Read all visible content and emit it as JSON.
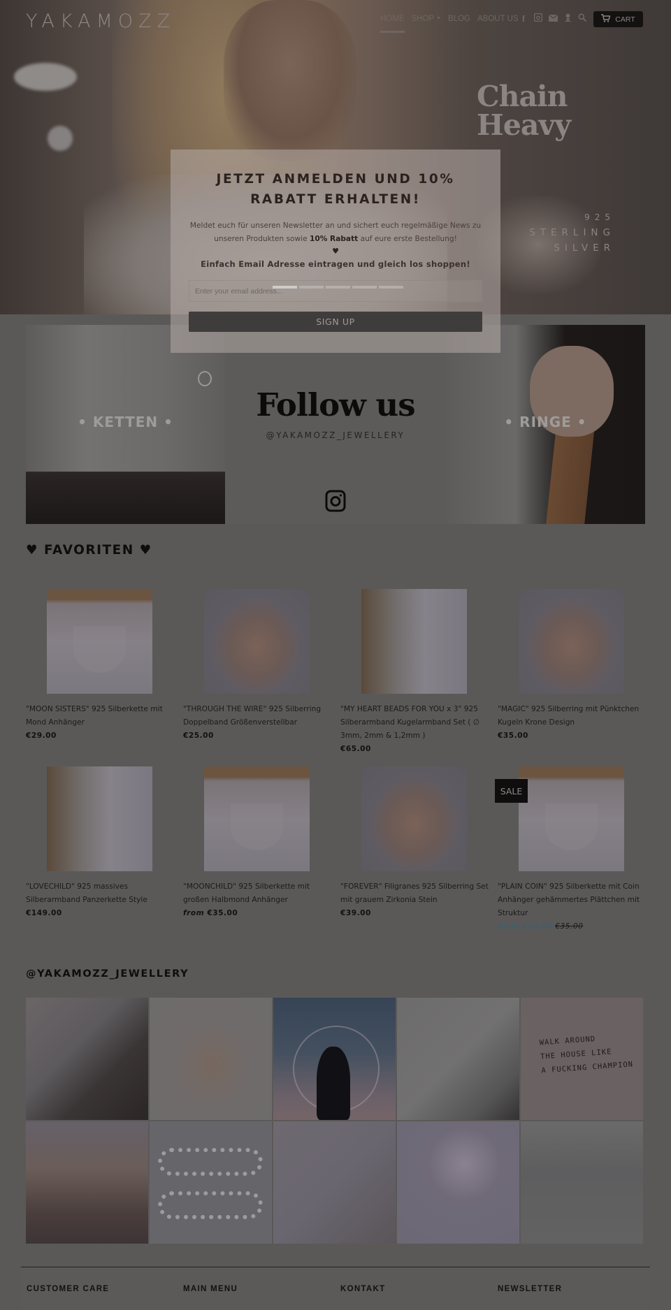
{
  "header": {
    "logo": "YAKAMOZZ",
    "nav": [
      {
        "label": "HOME",
        "active": true
      },
      {
        "label": "SHOP",
        "has_dropdown": true
      },
      {
        "label": "BLOG"
      },
      {
        "label": "ABOUT US"
      }
    ],
    "icons": [
      "facebook-icon",
      "instagram-icon",
      "mail-icon",
      "account-icon",
      "search-icon"
    ],
    "cart_label": "CART"
  },
  "hero": {
    "headline_line1": "Chain",
    "headline_line2": "Heavy",
    "sub_line1": "925",
    "sub_line2": "STERLING",
    "sub_line3": "SILVER"
  },
  "newsletter_popup": {
    "title": "JETZT ANMELDEN UND 10% RABATT ERHALTEN!",
    "desc_before": "Meldet euch für unseren Newsletter an und sichert euch regelmäßige News zu unseren Produkten sowie ",
    "desc_bold": "10% Rabatt",
    "desc_after": " auf eure erste Bestellung!",
    "heart": "♥",
    "cta": "Einfach Email Adresse eintragen und gleich los shoppen!",
    "email_placeholder": "Enter your email address...",
    "email_value": "",
    "button_label": "SIGN UP"
  },
  "promo": {
    "ketten_label": "• KETTEN •",
    "follow_title": "Follow us",
    "follow_handle": "@YAKAMOZZ_JEWELLERY",
    "ringe_label": "• RINGE •"
  },
  "favorites": {
    "title": "♥ FAVORITEN ♥",
    "products": [
      {
        "name": "\"MOON SISTERS\" 925 Silberkette mit Mond Anhänger",
        "price": "€29.00",
        "image": "shirt"
      },
      {
        "name": "\"THROUGH THE WIRE\" 925 Silberring Doppelband Größenverstellbar",
        "price": "€25.00",
        "image": "hand"
      },
      {
        "name": "\"MY HEART BEADS FOR YOU x 3\" 925 Silberarmband Kugelarmband Set ( ∅ 3mm, 2mm & 1,2mm )",
        "price": "€65.00",
        "image": "wrist"
      },
      {
        "name": "\"MAGIC\" 925 Silberring mit Pünktchen Kugeln Krone Design",
        "price": "€35.00",
        "image": "hand"
      },
      {
        "name": "\"LOVECHILD\" 925 massives Silberarmband Panzerkette Style",
        "price": "€149.00",
        "image": "wrist"
      },
      {
        "name": "\"MOONCHILD\" 925 Silberkette mit großen Halbmond Anhänger",
        "price_prefix": "from",
        "price": "€35.00",
        "image": "shirt"
      },
      {
        "name": "\"FOREVER\" Filigranes 925 Silberring Set mit grauem Zirkonia Stein",
        "price": "€39.00",
        "image": "hand"
      },
      {
        "name": "\"PLAIN COIN\" 925 Silberkette mit Coin Anhänger gehämmertes Plättchen mit Struktur",
        "price_prefix": "from",
        "price": "€25.00",
        "compare_price": "€35.00",
        "badge": "SALE",
        "image": "shirt"
      }
    ]
  },
  "instagram": {
    "title": "@YAKAMOZZ_JEWELLERY",
    "note_text": [
      "WALK AROUND",
      "THE HOUSE LIKE",
      "A FUCKING CHAMPION"
    ]
  },
  "footer": {
    "columns": [
      "CUSTOMER CARE",
      "MAIN MENU",
      "KONTAKT",
      "NEWSLETTER"
    ]
  },
  "colors": {
    "overlay": "#5a5958",
    "sale_price": "#3f5f6d",
    "cart_button": "#141211"
  }
}
